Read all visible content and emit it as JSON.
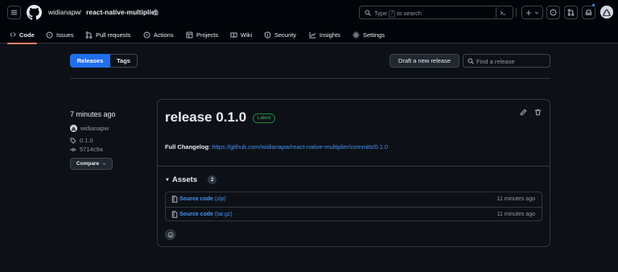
{
  "header": {
    "owner": "widianapw",
    "separator": "/",
    "repo": "react-native-multiplier",
    "search_prefix": "Type",
    "search_key": "/",
    "search_suffix": "to search"
  },
  "tabs": [
    {
      "label": "Code",
      "icon": "code-icon"
    },
    {
      "label": "Issues",
      "icon": "issue-icon"
    },
    {
      "label": "Pull requests",
      "icon": "pull-request-icon"
    },
    {
      "label": "Actions",
      "icon": "play-icon"
    },
    {
      "label": "Projects",
      "icon": "table-icon"
    },
    {
      "label": "Wiki",
      "icon": "book-icon"
    },
    {
      "label": "Security",
      "icon": "shield-icon"
    },
    {
      "label": "Insights",
      "icon": "graph-icon"
    },
    {
      "label": "Settings",
      "icon": "gear-icon"
    }
  ],
  "subnav": {
    "releases_label": "Releases",
    "tags_label": "Tags",
    "draft_label": "Draft a new release",
    "find_placeholder": "Find a release"
  },
  "release": {
    "time_ago": "7 minutes ago",
    "author": "widianapw",
    "tag": "0.1.0",
    "commit": "5714c9a",
    "compare_label": "Compare",
    "title": "release 0.1.0",
    "badge": "Latest",
    "changelog_label": "Full Changelog",
    "changelog_sep": ":",
    "changelog_url": "https://github.com/widianapw/react-native-multiplier/commits/0.1.0",
    "assets_label": "Assets",
    "assets_count": "2",
    "assets": [
      {
        "name": "Source code",
        "format": "(zip)",
        "time": "11 minutes ago"
      },
      {
        "name": "Source code",
        "format": "(tar.gz)",
        "time": "11 minutes ago"
      }
    ]
  },
  "colors": {
    "background": "#0d1117",
    "header": "#010409",
    "accent_blue": "#1f6feb",
    "link": "#4493f8",
    "latest_green": "#3fb950",
    "tab_underline": "#f78166"
  }
}
